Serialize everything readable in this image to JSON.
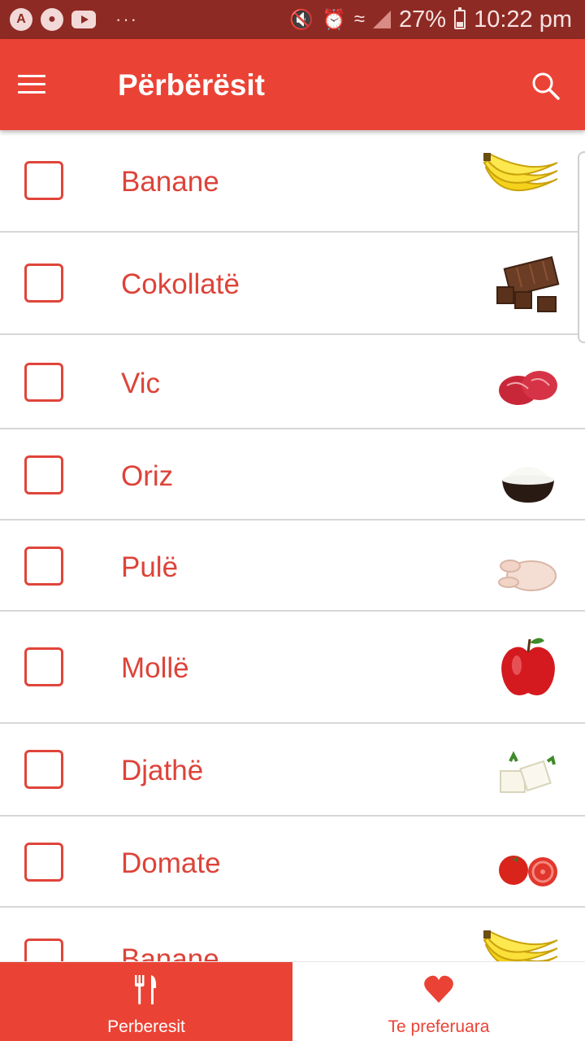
{
  "status_bar": {
    "battery": "27%",
    "time": "10:22 pm",
    "dots": "···"
  },
  "app_bar": {
    "title": "Përbërësit"
  },
  "list": {
    "items": [
      {
        "label": "Banane",
        "icon": "banana-icon"
      },
      {
        "label": "Cokollatë",
        "icon": "chocolate-icon"
      },
      {
        "label": "Vic",
        "icon": "beef-icon"
      },
      {
        "label": "Oriz",
        "icon": "rice-bowl-icon"
      },
      {
        "label": "Pulë",
        "icon": "chicken-icon"
      },
      {
        "label": "Mollë",
        "icon": "apple-icon"
      },
      {
        "label": "Djathë",
        "icon": "cheese-icon"
      },
      {
        "label": "Domate",
        "icon": "tomato-icon"
      },
      {
        "label": "Banane",
        "icon": "banana-icon"
      }
    ]
  },
  "bottom_nav": {
    "tabs": [
      {
        "label": "Perberesit",
        "icon": "fork-knife-icon",
        "active": true
      },
      {
        "label": "Te preferuara",
        "icon": "heart-icon",
        "active": false
      }
    ]
  },
  "colors": {
    "primary": "#ea4335",
    "status_bar": "#8e2a24",
    "text_accent": "#dd4339",
    "divider": "#d7d7d7"
  }
}
